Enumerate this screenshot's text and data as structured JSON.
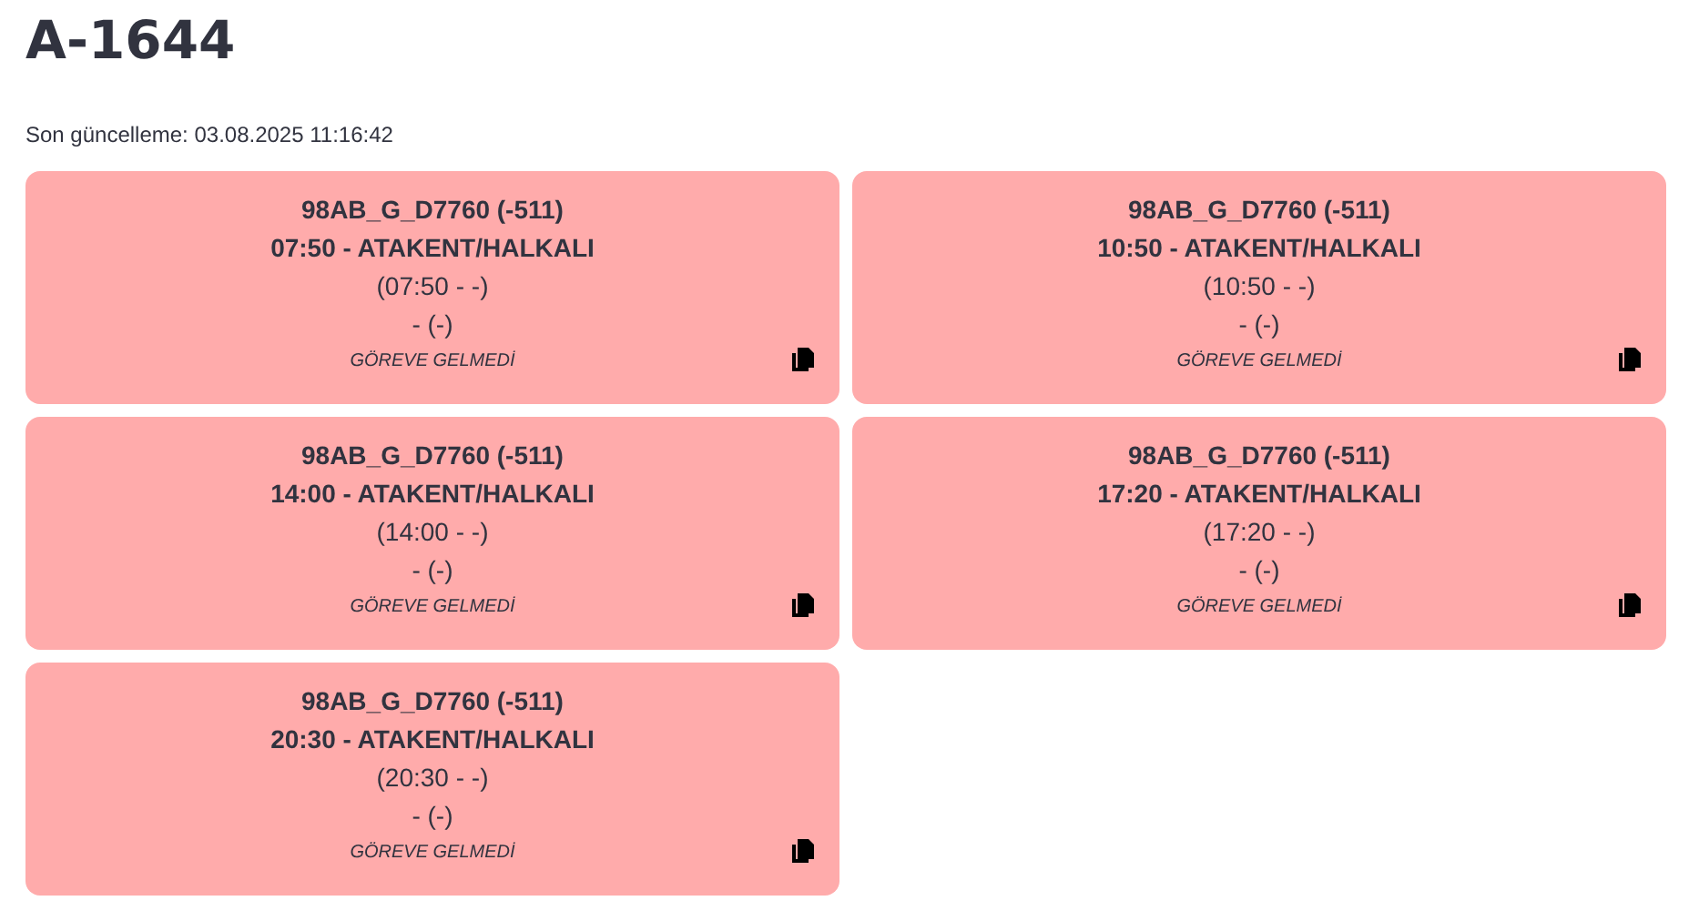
{
  "title": "A-1644",
  "last_update": "Son güncelleme: 03.08.2025 11:16:42",
  "cards": [
    {
      "vehicle": "98AB_G_D7760 (-511)",
      "trip": "07:50 - ATAKENT/HALKALI",
      "times": "(07:50 - -)",
      "driver": "- (-)",
      "status": "GÖREVE GELMEDİ"
    },
    {
      "vehicle": "98AB_G_D7760 (-511)",
      "trip": "10:50 - ATAKENT/HALKALI",
      "times": "(10:50 - -)",
      "driver": "- (-)",
      "status": "GÖREVE GELMEDİ"
    },
    {
      "vehicle": "98AB_G_D7760 (-511)",
      "trip": "14:00 - ATAKENT/HALKALI",
      "times": "(14:00 - -)",
      "driver": "- (-)",
      "status": "GÖREVE GELMEDİ"
    },
    {
      "vehicle": "98AB_G_D7760 (-511)",
      "trip": "17:20 - ATAKENT/HALKALI",
      "times": "(17:20 - -)",
      "driver": "- (-)",
      "status": "GÖREVE GELMEDİ"
    },
    {
      "vehicle": "98AB_G_D7760 (-511)",
      "trip": "20:30 - ATAKENT/HALKALI",
      "times": "(20:30 - -)",
      "driver": "- (-)",
      "status": "GÖREVE GELMEDİ"
    }
  ]
}
